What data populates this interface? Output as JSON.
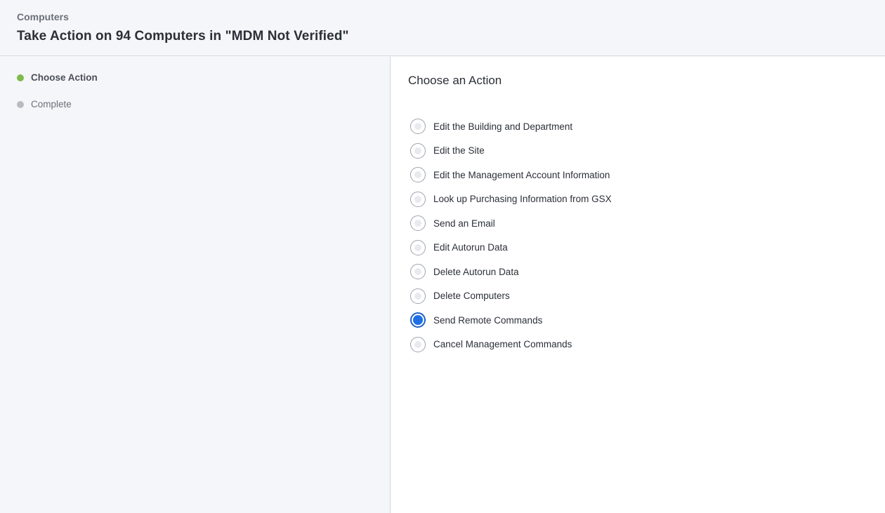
{
  "header": {
    "breadcrumb": "Computers",
    "title": "Take Action on 94 Computers in \"MDM Not Verified\""
  },
  "steps": [
    {
      "label": "Choose Action",
      "status": "active",
      "dot_color": "#7dbb4a"
    },
    {
      "label": "Complete",
      "status": "inactive",
      "dot_color": "#b8bbc1"
    }
  ],
  "main": {
    "section_title": "Choose an Action",
    "selected_index": 8,
    "options": [
      {
        "label": "Edit the Building and Department"
      },
      {
        "label": "Edit the Site"
      },
      {
        "label": "Edit the Management Account Information"
      },
      {
        "label": "Look up Purchasing Information from GSX"
      },
      {
        "label": "Send an Email"
      },
      {
        "label": "Edit Autorun Data"
      },
      {
        "label": "Delete Autorun Data"
      },
      {
        "label": "Delete Computers"
      },
      {
        "label": "Send Remote Commands"
      },
      {
        "label": "Cancel Management Commands"
      }
    ]
  },
  "colors": {
    "accent": "#1f6fe5",
    "active_step": "#7dbb4a",
    "inactive_step": "#b8bbc1"
  }
}
